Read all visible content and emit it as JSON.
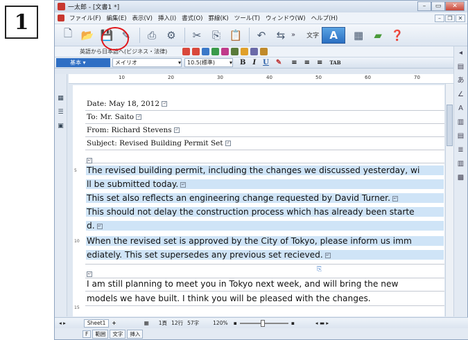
{
  "step_number": "1",
  "window": {
    "title": "一太郎 - [文書1 *]"
  },
  "menu": [
    "ファイル(F)",
    "編集(E)",
    "表示(V)",
    "挿入(I)",
    "書式(O)",
    "罫線(K)",
    "ツール(T)",
    "ウィンドウ(W)",
    "ヘルプ(H)"
  ],
  "toolbar": {
    "mode_label": "文字",
    "a_label": "A",
    "more": "»"
  },
  "toolbar2": {
    "translate_label": "英語から日本語へ(ビジネス・法律)"
  },
  "format": {
    "style": "基本",
    "font": "メイリオ",
    "size": "10.5(標準)",
    "bold": "B",
    "italic": "I",
    "underline": "U"
  },
  "ruler": [
    "10",
    "20",
    "30",
    "40",
    "50",
    "60",
    "70"
  ],
  "document": {
    "date": "Date: May 18, 2012",
    "to": "To: Mr. Saito",
    "from": "From: Richard Stevens",
    "subject": "Subject: Revised Building Permit Set",
    "l1": "The revised building permit, including the changes we discussed yesterday, wi",
    "l2": "ll be submitted today.",
    "l3": "This set also reflects an engineering change requested by David Turner.",
    "l4": "This should not delay the construction process which has already been starte",
    "l5": "d.",
    "l6": "When the revised set is approved by the City of Tokyo, please inform us imm",
    "l7": "ediately. This set supersedes any previous set recieved.",
    "l8": "I am still planning to meet you in Tokyo next week, and will bring the new",
    "l9": "models we have built. I think you will be pleased with the changes."
  },
  "status": {
    "sheet": "Sheet1",
    "page": "1頁",
    "line": "12行",
    "col": "57字",
    "zoom": "120%"
  },
  "modebar": [
    "F",
    "範囲",
    "文字",
    "挿入"
  ]
}
